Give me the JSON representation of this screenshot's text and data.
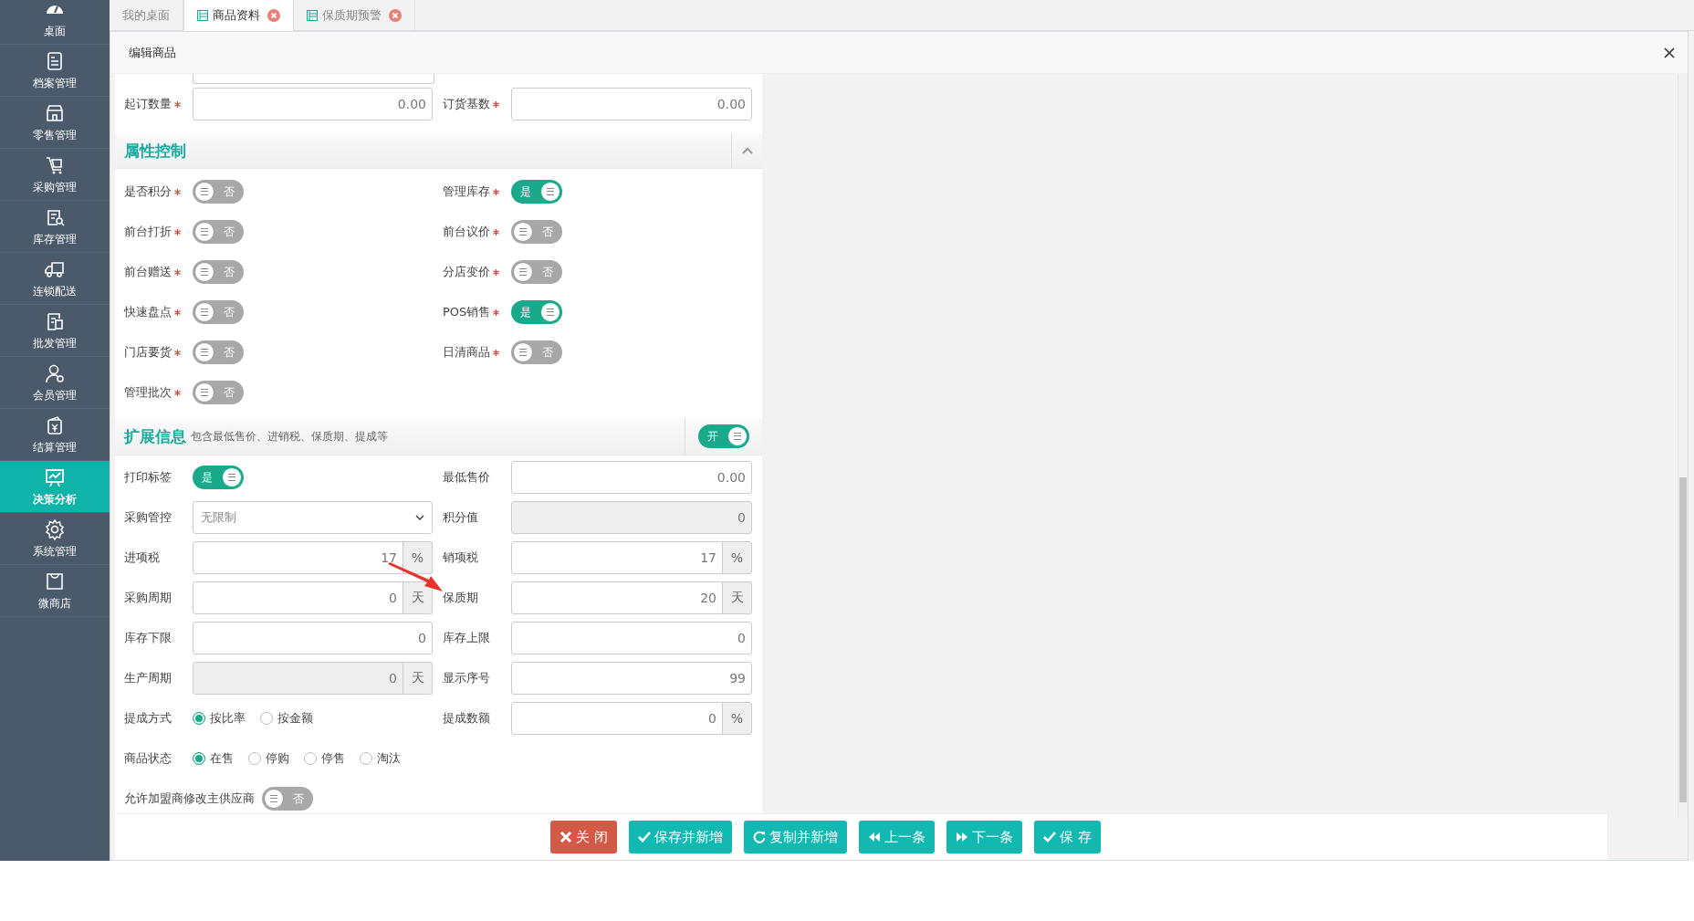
{
  "sidebar": {
    "items": [
      {
        "label": "桌面",
        "selected": false
      },
      {
        "label": "档案管理",
        "selected": false
      },
      {
        "label": "零售管理",
        "selected": false
      },
      {
        "label": "采购管理",
        "selected": false
      },
      {
        "label": "库存管理",
        "selected": false
      },
      {
        "label": "连锁配送",
        "selected": false
      },
      {
        "label": "批发管理",
        "selected": false
      },
      {
        "label": "会员管理",
        "selected": false
      },
      {
        "label": "结算管理",
        "selected": false
      },
      {
        "label": "决策分析",
        "selected": true
      },
      {
        "label": "系统管理",
        "selected": false
      },
      {
        "label": "微商店",
        "selected": false
      }
    ]
  },
  "tabs": [
    {
      "label": "我的桌面",
      "selected": false,
      "closable": false
    },
    {
      "label": "商品资料",
      "selected": true,
      "closable": true
    },
    {
      "label": "保质期预警",
      "selected": false,
      "closable": true
    }
  ],
  "dialog": {
    "title": "编辑商品",
    "top_fields": [
      {
        "label": "起订数量",
        "required": true,
        "value": "0.00"
      },
      {
        "label": "订货基数",
        "required": true,
        "value": "0.00"
      }
    ],
    "attribute_section": {
      "title": "属性控制",
      "expanded": true,
      "toggles": [
        {
          "label": "是否积分",
          "required": true,
          "on": false,
          "text": "否"
        },
        {
          "label": "管理库存",
          "required": true,
          "on": true,
          "text": "是"
        },
        {
          "label": "前台打折",
          "required": true,
          "on": false,
          "text": "否"
        },
        {
          "label": "前台议价",
          "required": true,
          "on": false,
          "text": "否"
        },
        {
          "label": "前台赠送",
          "required": true,
          "on": false,
          "text": "否"
        },
        {
          "label": "分店变价",
          "required": true,
          "on": false,
          "text": "否"
        },
        {
          "label": "快速盘点",
          "required": true,
          "on": false,
          "text": "否"
        },
        {
          "label": "POS销售",
          "required": true,
          "on": true,
          "text": "是"
        },
        {
          "label": "门店要货",
          "required": true,
          "on": false,
          "text": "否"
        },
        {
          "label": "日清商品",
          "required": true,
          "on": false,
          "text": "否"
        },
        {
          "label": "管理批次",
          "required": true,
          "on": false,
          "text": "否"
        }
      ]
    },
    "extended_section": {
      "title": "扩展信息",
      "subtitle": "包含最低售价、进销税、保质期、提成等",
      "switch": {
        "on": true,
        "text": "开"
      },
      "rows": [
        [
          {
            "kind": "toggle",
            "label": "打印标签",
            "on": true,
            "text": "是"
          },
          {
            "kind": "input",
            "label": "最低售价",
            "value": "0.00",
            "disabled": false
          }
        ],
        [
          {
            "kind": "select",
            "label": "采购管控",
            "value": "无限制"
          },
          {
            "kind": "input",
            "label": "积分值",
            "value": "0",
            "disabled": true
          }
        ],
        [
          {
            "kind": "input",
            "label": "进项税",
            "value": "17",
            "unit": "%",
            "disabled": false
          },
          {
            "kind": "input",
            "label": "销项税",
            "value": "17",
            "unit": "%",
            "disabled": false
          }
        ],
        [
          {
            "kind": "input",
            "label": "采购周期",
            "value": "0",
            "unit": "天",
            "disabled": false
          },
          {
            "kind": "input",
            "label": "保质期",
            "value": "20",
            "unit": "天",
            "disabled": false
          }
        ],
        [
          {
            "kind": "input",
            "label": "库存下限",
            "value": "0",
            "disabled": false
          },
          {
            "kind": "input",
            "label": "库存上限",
            "value": "0",
            "disabled": false
          }
        ],
        [
          {
            "kind": "input",
            "label": "生产周期",
            "value": "0",
            "unit": "天",
            "disabled": true
          },
          {
            "kind": "input",
            "label": "显示序号",
            "value": "99",
            "disabled": false
          }
        ],
        [
          {
            "kind": "radio",
            "label": "提成方式",
            "options": [
              {
                "label": "按比率",
                "selected": true
              },
              {
                "label": "按金额",
                "selected": false
              }
            ]
          },
          {
            "kind": "input",
            "label": "提成数额",
            "value": "0",
            "unit": "%",
            "disabled": false
          }
        ],
        [
          {
            "kind": "radio",
            "label": "商品状态",
            "options": [
              {
                "label": "在售",
                "selected": true
              },
              {
                "label": "停购",
                "selected": false
              },
              {
                "label": "停售",
                "selected": false
              },
              {
                "label": "淘汰",
                "selected": false
              }
            ]
          }
        ],
        [
          {
            "kind": "toggle",
            "label": "允许加盟商修改主供应商",
            "on": false,
            "text": "否"
          }
        ]
      ]
    },
    "buttons": [
      {
        "label": "关 闭",
        "kind": "close"
      },
      {
        "label": "保存并新增",
        "kind": "save_new"
      },
      {
        "label": "复制并新增",
        "kind": "copy_new"
      },
      {
        "label": "上一条",
        "kind": "prev"
      },
      {
        "label": "下一条",
        "kind": "next"
      },
      {
        "label": "保 存",
        "kind": "save"
      }
    ]
  }
}
